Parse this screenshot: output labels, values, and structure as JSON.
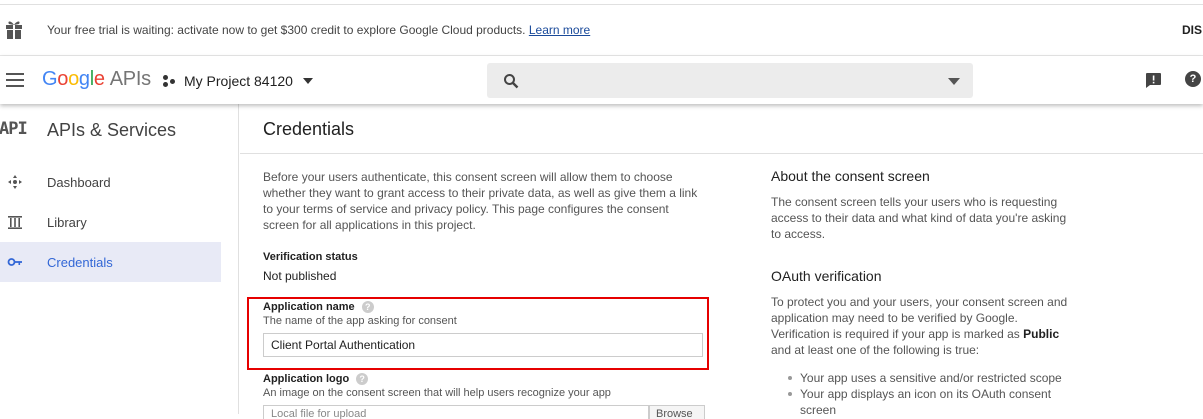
{
  "banner": {
    "text": "Your free trial is waiting: activate now to get $300 credit to explore Google Cloud products.",
    "link": "Learn more",
    "dismiss": "DIS"
  },
  "header": {
    "logo_letters": [
      "G",
      "o",
      "o",
      "g",
      "l",
      "e"
    ],
    "logo_suffix": "APIs",
    "project_name": "My Project 84120",
    "search_placeholder": ""
  },
  "sidebar": {
    "icon_text": "API",
    "title": "APIs & Services",
    "items": [
      {
        "label": "Dashboard",
        "icon": "dashboard-icon",
        "active": false
      },
      {
        "label": "Library",
        "icon": "library-icon",
        "active": false
      },
      {
        "label": "Credentials",
        "icon": "key-icon",
        "active": true
      }
    ]
  },
  "main": {
    "title": "Credentials",
    "intro": "Before your users authenticate, this consent screen will allow them to choose whether they want to grant access to their private data, as well as give them a link to your terms of service and privacy policy. This page configures the consent screen for all applications in this project.",
    "verification_label": "Verification status",
    "verification_value": "Not published",
    "app_name_label": "Application name",
    "app_name_hint": "The name of the app asking for consent",
    "app_name_value": "Client Portal Authentication",
    "app_logo_label": "Application logo",
    "app_logo_hint": "An image on the consent screen that will help users recognize your app",
    "logo_field_text": "Local file for upload",
    "logo_button": "Browse",
    "help_glyph": "?"
  },
  "info": {
    "about_title": "About the consent screen",
    "about_text": "The consent screen tells your users who is requesting access to their data and what kind of data you're asking to access.",
    "oauth_title": "OAuth verification",
    "oauth_text_1": "To protect you and your users, your consent screen and application may need to be verified by Google. Verification is required if your app is marked as",
    "oauth_bold": "Public",
    "oauth_text_2": "and at least one of the following is true:",
    "bullets": [
      "Your app uses a sensitive and/or restricted scope",
      "Your app displays an icon on its OAuth consent screen"
    ]
  },
  "colors": {
    "accent": "#3367d6",
    "highlight": "#e60000",
    "active_bg": "#e8eaf6"
  }
}
